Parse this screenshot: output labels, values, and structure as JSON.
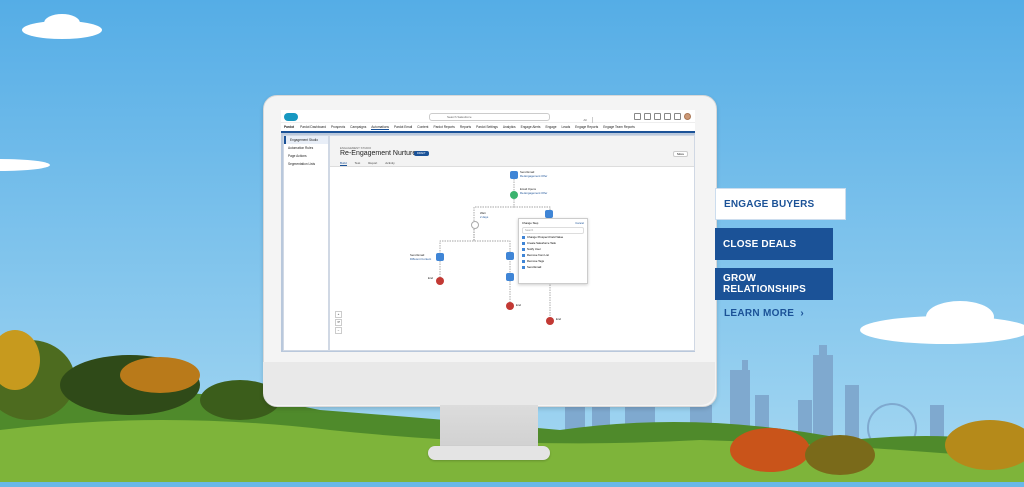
{
  "app": {
    "name": "Pardot",
    "search_scope": "All",
    "search_placeholder": "Search Salesforce",
    "nav_items": [
      "Pardot Dashboard",
      "Prospects",
      "Campaigns",
      "Automations",
      "Pardot Email",
      "Content",
      "Pardot Reports",
      "Reports",
      "Pardot Settings",
      "Analytics",
      "Engage Alerts",
      "Engage",
      "Leads",
      "Engage Reports",
      "Engage Team Reports"
    ],
    "active_nav": "Automations",
    "left_nav": [
      "Engagement Studio",
      "Automation Rules",
      "Page Actions",
      "Segmentation Lists"
    ],
    "left_nav_selected": "Engagement Studio"
  },
  "record": {
    "type_label": "ENGAGEMENT STUDIO",
    "title": "Re-Engagement Nurture",
    "badge": "DRAFT",
    "more_label": "More",
    "tabs": [
      "Build",
      "Test",
      "Report",
      "Activity"
    ],
    "selected_tab": "Build"
  },
  "flow": {
    "nodes": [
      {
        "title": "Send Email",
        "sub": "Re-Engagement Offer"
      },
      {
        "title": "Email Opens",
        "sub": "Re-Engagement Offer"
      },
      {
        "title": "Send Email",
        "sub": "Different Content"
      },
      {
        "title": "Wait",
        "sub": "2 days"
      },
      {
        "title": "End",
        "sub": ""
      },
      {
        "title": "End",
        "sub": ""
      },
      {
        "title": "End",
        "sub": ""
      }
    ],
    "dropdown": {
      "header": "Change Step",
      "cancel": "Cancel",
      "search": "Search",
      "items": [
        "Change Prospect Field Value",
        "Create Salesforce Task",
        "Notify User",
        "Remove from List",
        "Remove Tags",
        "Send Email"
      ]
    },
    "zoom_controls": [
      "+",
      "↺",
      "−"
    ]
  },
  "cta": {
    "engage_buyers": "ENGAGE BUYERS",
    "close_deals": "CLOSE DEALS",
    "grow_relationships": "GROW RELATIONSHIPS",
    "learn_more": "LEARN MORE"
  },
  "colors": {
    "brand": "#1b5297",
    "sky": "#68b8e8",
    "accent_blue": "#3f85d6",
    "green": "#3bb36e",
    "red": "#c23934"
  }
}
